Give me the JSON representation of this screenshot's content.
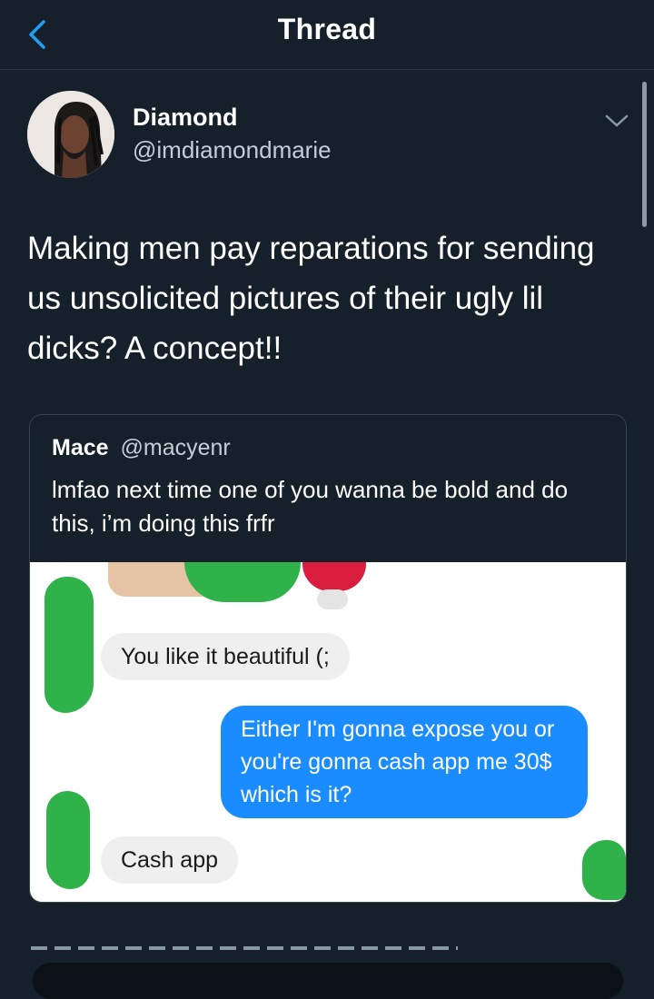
{
  "header": {
    "title": "Thread"
  },
  "tweet": {
    "author_name": "Diamond",
    "author_handle": "@imdiamondmarie",
    "text": "Making men pay reparations for sending us unsolicited pictures of their ugly lil dicks? A concept!!"
  },
  "quote": {
    "author_name": "Mace",
    "author_handle": "@macyenr",
    "text": "lmfao next time one of you wanna be bold and do this, i’m doing this frfr",
    "image": {
      "messages": [
        {
          "side": "in",
          "text": "You like it beautiful (;"
        },
        {
          "side": "out",
          "text": "Either I'm gonna expose you or you're gonna cash app me 30$ which is it?"
        },
        {
          "side": "in",
          "text": "Cash app"
        }
      ]
    }
  },
  "colors": {
    "background": "#15202b",
    "accent": "#1da1f2",
    "outgoing_bubble": "#1a8cff",
    "incoming_bubble": "#efefef",
    "censor_green": "#2fb24a"
  },
  "icons": {
    "back": "back-chevron-icon",
    "menu": "chevron-down-icon"
  }
}
